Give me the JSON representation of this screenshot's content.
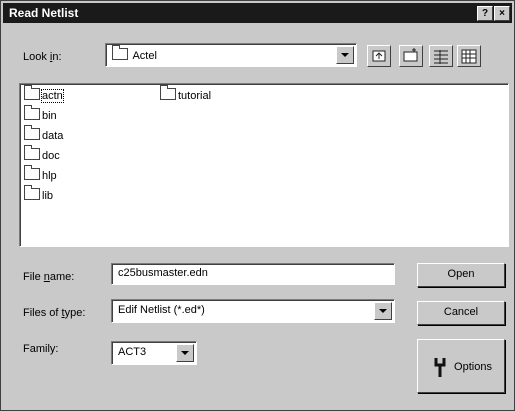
{
  "window": {
    "title": "Read Netlist",
    "help_label": "?",
    "close_label": "×"
  },
  "look_in": {
    "label_pre": "Look ",
    "label_u": "i",
    "label_post": "n:",
    "value": "Actel"
  },
  "toolbar": {
    "icons": [
      "up-one-level-icon",
      "create-new-folder-icon",
      "list-view-icon",
      "details-view-icon"
    ]
  },
  "files": [
    "actn",
    "bin",
    "data",
    "doc",
    "hlp",
    "lib",
    "tutorial"
  ],
  "file_name": {
    "label_pre": "File ",
    "label_u": "n",
    "label_post": "ame:",
    "value": "c25busmaster.edn"
  },
  "file_type": {
    "label_pre": "Files of ",
    "label_u": "t",
    "label_post": "ype:",
    "value": "Edif Netlist (*.ed*)"
  },
  "family": {
    "label": "Family:",
    "value": "ACT3"
  },
  "buttons": {
    "open": "Open",
    "cancel": "Cancel",
    "options": "Options"
  }
}
